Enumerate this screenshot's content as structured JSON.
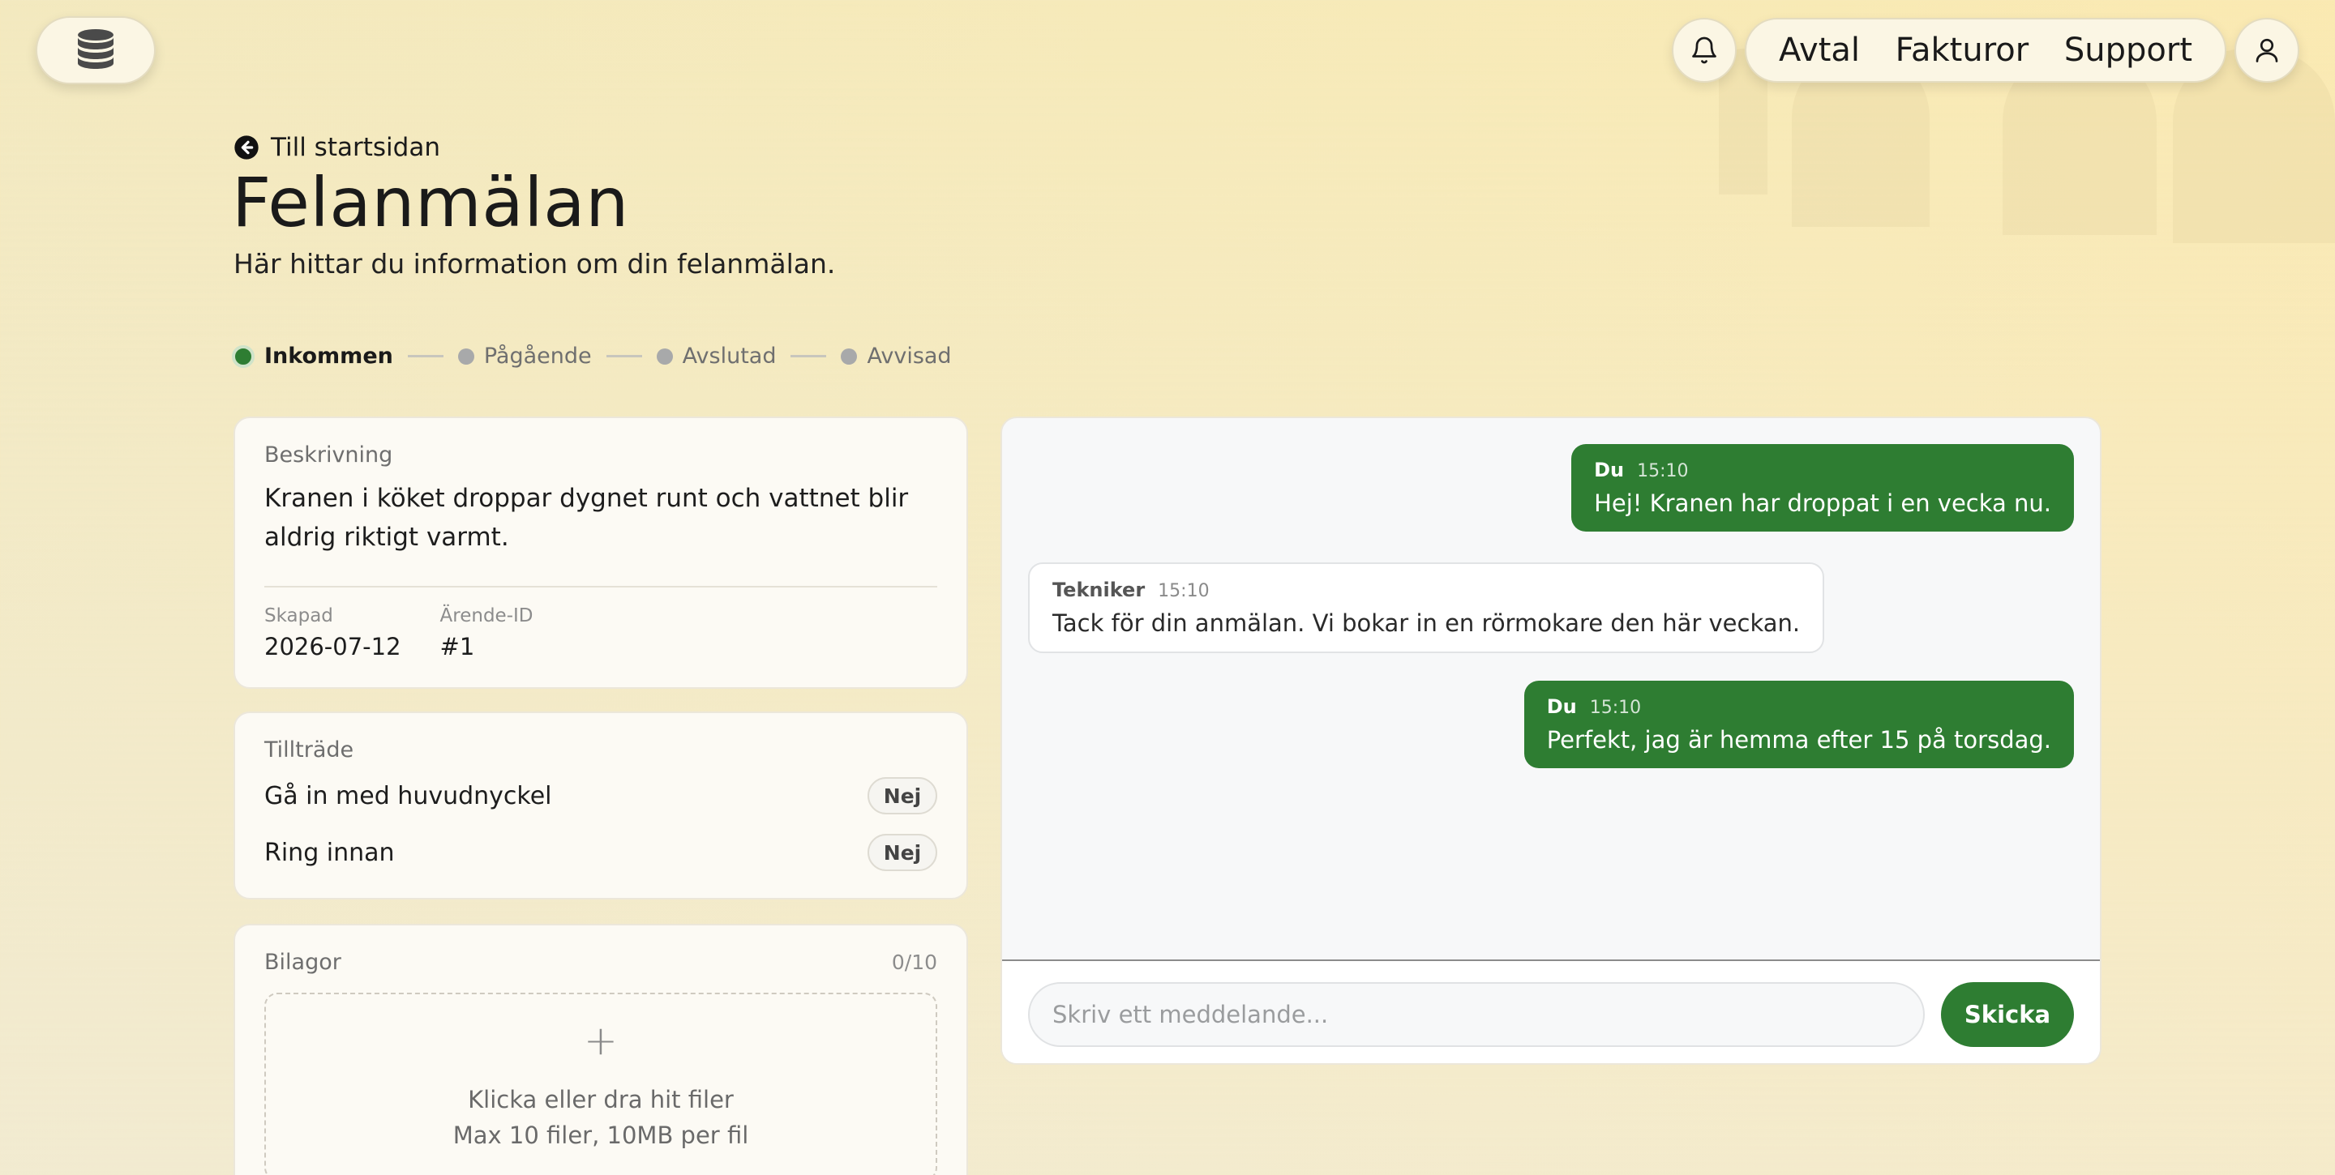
{
  "header": {
    "nav": [
      "Avtal",
      "Fakturor",
      "Support"
    ]
  },
  "page": {
    "back_link": "Till startsidan",
    "title": "Felanmälan",
    "subtitle": "Här hittar du information om din felanmälan."
  },
  "status_steps": [
    {
      "label": "Inkommen",
      "active": true
    },
    {
      "label": "Pågående",
      "active": false
    },
    {
      "label": "Avslutad",
      "active": false
    },
    {
      "label": "Avvisad",
      "active": false
    }
  ],
  "description": {
    "label": "Beskrivning",
    "text": "Kranen i köket droppar dygnet runt och vattnet blir aldrig riktigt varmt.",
    "created_label": "Skapad",
    "created_value": "2026-07-12",
    "id_label": "Ärende-ID",
    "id_value": "#1"
  },
  "access": {
    "label": "Tillträde",
    "items": [
      {
        "label": "Gå in med huvudnyckel",
        "value": "Nej"
      },
      {
        "label": "Ring innan",
        "value": "Nej"
      }
    ]
  },
  "attachments": {
    "label": "Bilagor",
    "count": "0/10",
    "drop_text": "Klicka eller dra hit filer",
    "limit_text": "Max 10 filer, 10MB per fil"
  },
  "chat": {
    "messages": [
      {
        "author": "Du",
        "time": "15:10",
        "text": "Hej! Kranen har droppat i en vecka nu.",
        "own": true
      },
      {
        "author": "Tekniker",
        "time": "15:10",
        "text": "Tack för din anmälan. Vi bokar in en rörmokare den här veckan.",
        "own": false
      },
      {
        "author": "Du",
        "time": "15:10",
        "text": "Perfekt, jag är hemma efter 15 på torsdag.",
        "own": true
      }
    ],
    "input_placeholder": "Skriv ett meddelande...",
    "send_label": "Skicka"
  },
  "colors": {
    "accent": "#2e7d32",
    "background": "#f7eab8"
  }
}
